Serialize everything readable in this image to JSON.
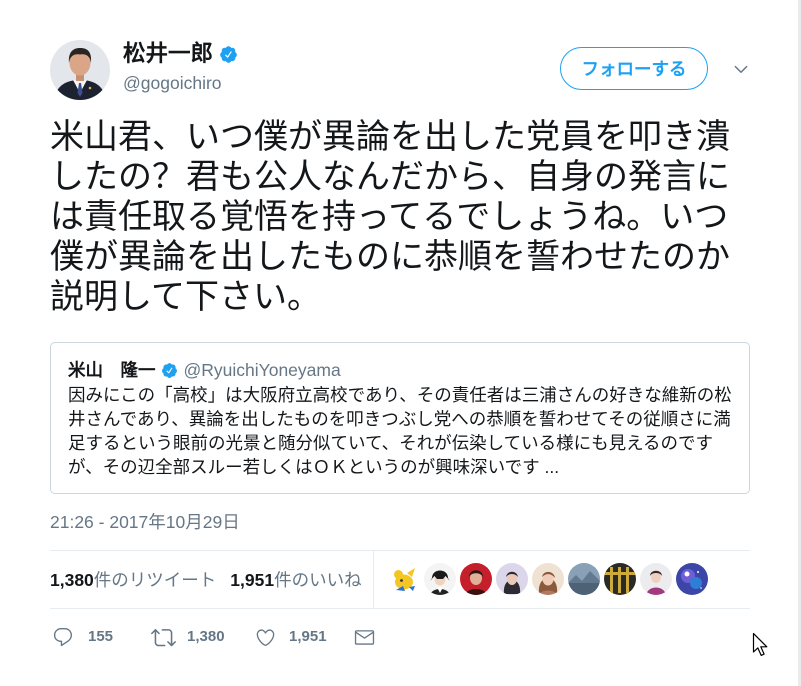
{
  "colors": {
    "text": "#14171a",
    "secondary": "#657786",
    "accent": "#1da1f2",
    "divider": "#e6ecf0",
    "quote_border": "#ccd6dd"
  },
  "author": {
    "name": "松井一郎",
    "handle": "@gogoichiro",
    "verified": true
  },
  "follow_button": {
    "label": "フォローする"
  },
  "menu_icon": "chevron-down-icon",
  "tweet": {
    "lines": [
      "米山君、いつ僕が異論を出した党員を叩き潰",
      "したの？君も公人なんだから、自身の発言に",
      "は責任取る覚悟を持ってるでしょうね。いつ",
      "僕が異論を出したものに恭順を誓わせたのか",
      "説明して下さい。"
    ]
  },
  "quoted_tweet": {
    "name": "米山　隆一",
    "handle": "@RyuichiYoneyama",
    "verified": true,
    "lines": [
      "因みにこの「高校」は大阪府立高校であり、その責任者は三浦さんの好きな維新の松",
      "井さんであり、異論を出したものを叩きつぶし党への恭順を誓わせてその従順さに満",
      "足するという眼前の光景と随分似ていて、それが伝染している様にも見えるのです",
      "が、その辺全部スルー若しくはＯＫというのが興味深いです ..."
    ]
  },
  "timestamp": "21:26 - 2017年10月29日",
  "stats": {
    "retweets": {
      "count": "1,380",
      "label": "件のリツイート"
    },
    "likes": {
      "count": "1,951",
      "label": "件のいいね"
    }
  },
  "actions": {
    "reply": {
      "icon": "reply-icon",
      "count": "155"
    },
    "retweet": {
      "icon": "retweet-icon",
      "count": "1,380"
    },
    "like": {
      "icon": "heart-icon",
      "count": "1,951"
    },
    "dm": {
      "icon": "envelope-icon"
    }
  }
}
